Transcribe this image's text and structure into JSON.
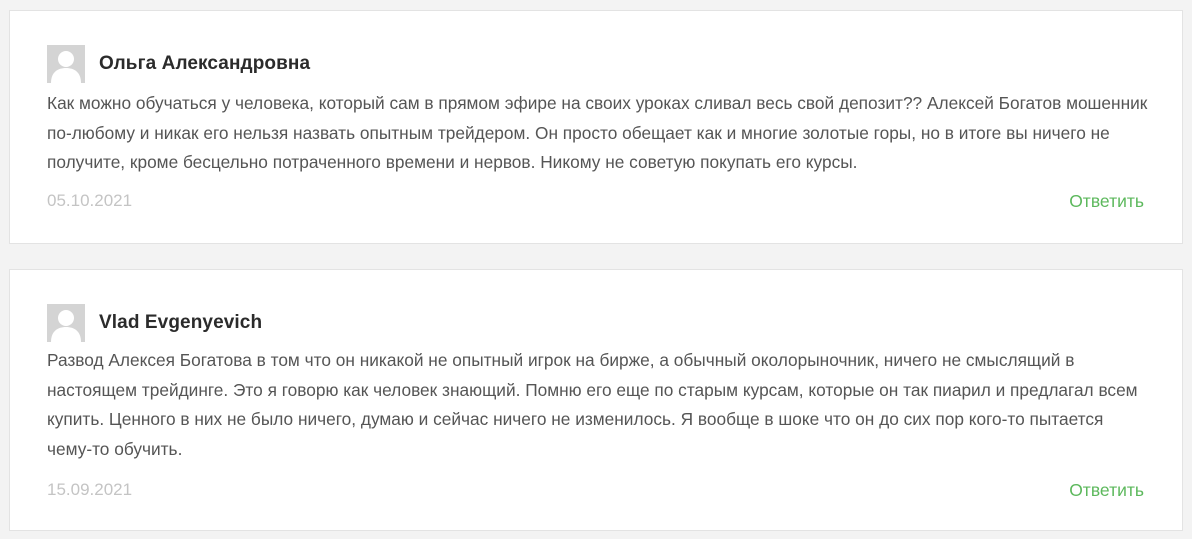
{
  "comments": [
    {
      "author": "Ольга Александровна",
      "text": "Как можно обучаться у человека, который сам в прямом эфире на своих уроках сливал весь свой депозит?? Алексей Богатов мошенник по-любому и никак его нельзя назвать опытным трейдером. Он просто обещает как и многие золотые горы, но в итоге вы ничего не получите, кроме бесцельно потраченного времени и нервов. Никому не советую покупать его курсы.",
      "date": "05.10.2021",
      "reply_label": "Ответить"
    },
    {
      "author": "Vlad Evgenyevich",
      "text": "Развод Алексея Богатова в том что он никакой не опытный игрок на бирже, а обычный околорыночник, ничего не смыслящий в настоящем трейдинге. Это я говорю как человек знающий. Помню его еще по старым курсам, которые он так пиарил и предлагал всем купить. Ценного в них не было ничего, думаю и сейчас ничего не изменилось. Я вообще в шоке что он до сих пор кого-то пытается чему-то обучить.",
      "date": "15.09.2021",
      "reply_label": "Ответить"
    }
  ],
  "colors": {
    "reply": "#5cb85c",
    "date": "#c4c4c4",
    "text": "#555555",
    "author": "#2b2b2b"
  },
  "icons": {
    "avatar": "default-user-avatar-icon"
  }
}
